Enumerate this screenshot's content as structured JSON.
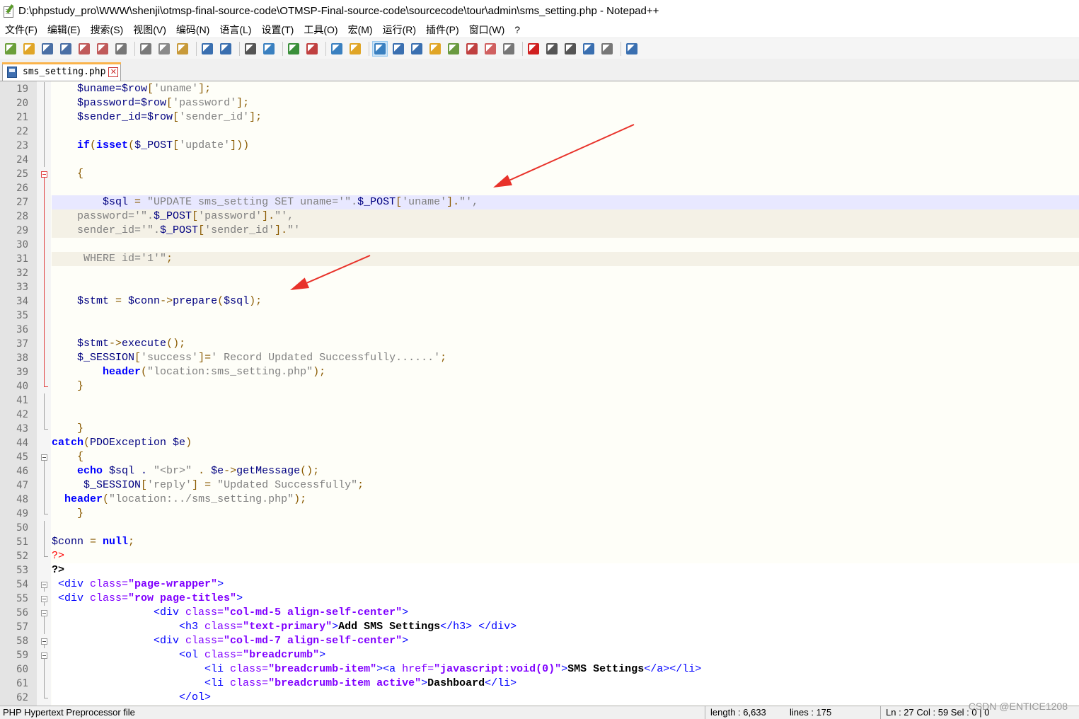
{
  "window": {
    "title": "D:\\phpstudy_pro\\WWW\\shenji\\otmsp-final-source-code\\OTMSP-Final-source-code\\sourcecode\\tour\\admin\\sms_setting.php - Notepad++"
  },
  "menu": [
    "文件(F)",
    "编辑(E)",
    "搜索(S)",
    "视图(V)",
    "编码(N)",
    "语言(L)",
    "设置(T)",
    "工具(O)",
    "宏(M)",
    "运行(R)",
    "插件(P)",
    "窗口(W)",
    "?"
  ],
  "toolbar": {
    "icons": [
      "new-file-icon",
      "open-file-icon",
      "save-icon",
      "save-all-icon",
      "close-icon",
      "close-all-icon",
      "print-icon",
      "|",
      "cut-icon",
      "copy-icon",
      "paste-icon",
      "|",
      "undo-icon",
      "redo-icon",
      "|",
      "find-icon",
      "replace-icon",
      "|",
      "zoom-in-icon",
      "zoom-out-icon",
      "|",
      "sync-vertical-icon",
      "sync-horizontal-icon",
      "|",
      "word-wrap-icon",
      "show-all-chars-icon",
      "indent-guide-icon",
      "user-language-icon",
      "doc-map-icon",
      "function-list-icon",
      "folder-workspace-icon",
      "monitor-icon",
      "|",
      "record-macro-icon",
      "stop-record-icon",
      "play-macro-icon",
      "run-macro-multiple-icon",
      "save-macro-icon",
      "|",
      "spell-check-icon"
    ],
    "icon_colors": [
      "#6b9f3a",
      "#e0a526",
      "#4a6fa5",
      "#4a6fa5",
      "#c05a5a",
      "#c05a5a",
      "#777777",
      "|",
      "#7a7a7a",
      "#8a8a8a",
      "#c89a3a",
      "|",
      "#3a6fb0",
      "#3a6fb0",
      "|",
      "#555555",
      "#3a80c0",
      "|",
      "#3a8f3a",
      "#c04040",
      "|",
      "#3a80c0",
      "#e0a526",
      "|",
      "#3a80c0",
      "#3a6fb0",
      "#3a6fb0",
      "#e0a526",
      "#6a9a40",
      "#c04040",
      "#d06060",
      "#777777",
      "|",
      "#d02020",
      "#555555",
      "#555555",
      "#3a6fb0",
      "#777777",
      "|",
      "#3a6fb0"
    ],
    "active_index": [
      24,
      40
    ]
  },
  "tab": {
    "label": "sms_setting.php",
    "close": "✕"
  },
  "editor": {
    "lines": [
      {
        "n": "19",
        "fold": "line",
        "tokens": [
          [
            "    ",
            "t"
          ],
          [
            "$uname=$row",
            "v"
          ],
          [
            "[",
            "o"
          ],
          [
            "'uname'",
            "s"
          ],
          [
            "];",
            "o"
          ]
        ]
      },
      {
        "n": "20",
        "fold": "line",
        "tokens": [
          [
            "    ",
            "t"
          ],
          [
            "$password=$row",
            "v"
          ],
          [
            "[",
            "o"
          ],
          [
            "'password'",
            "s"
          ],
          [
            "];",
            "o"
          ]
        ]
      },
      {
        "n": "21",
        "fold": "line",
        "tokens": [
          [
            "    ",
            "t"
          ],
          [
            "$sender_id=$row",
            "v"
          ],
          [
            "[",
            "o"
          ],
          [
            "'sender_id'",
            "s"
          ],
          [
            "];",
            "o"
          ]
        ]
      },
      {
        "n": "22",
        "fold": "line",
        "tokens": []
      },
      {
        "n": "23",
        "fold": "line",
        "tokens": [
          [
            "    ",
            "t"
          ],
          [
            "if",
            "k"
          ],
          [
            "(",
            "o"
          ],
          [
            "isset",
            "k"
          ],
          [
            "(",
            "o"
          ],
          [
            "$_POST",
            "v"
          ],
          [
            "[",
            "o"
          ],
          [
            "'update'",
            "s"
          ],
          [
            "]))",
            "o"
          ]
        ]
      },
      {
        "n": "24",
        "fold": "line",
        "tokens": []
      },
      {
        "n": "25",
        "fold": "box-red",
        "tokens": [
          [
            "    ",
            "t"
          ],
          [
            "{",
            "o"
          ]
        ]
      },
      {
        "n": "26",
        "fold": "line-red",
        "tokens": []
      },
      {
        "n": "27",
        "fold": "line-red",
        "hl": "cur",
        "tokens": [
          [
            "        ",
            "t"
          ],
          [
            "$sql",
            "v"
          ],
          [
            " = ",
            "o"
          ],
          [
            "\"UPDATE sms_setting SET uname='\".",
            "s"
          ],
          [
            "$_POST",
            "v"
          ],
          [
            "[",
            "o"
          ],
          [
            "'uname'",
            "s"
          ],
          [
            "].",
            "o"
          ],
          [
            "\"',",
            "s"
          ]
        ]
      },
      {
        "n": "28",
        "fold": "line-red",
        "hl": "shade",
        "tokens": [
          [
            "    ",
            "t"
          ],
          [
            "password='\".",
            "s"
          ],
          [
            "$_POST",
            "v"
          ],
          [
            "[",
            "o"
          ],
          [
            "'password'",
            "s"
          ],
          [
            "].",
            "o"
          ],
          [
            "\"',",
            "s"
          ]
        ]
      },
      {
        "n": "29",
        "fold": "line-red",
        "hl": "shade",
        "tokens": [
          [
            "    ",
            "t"
          ],
          [
            "sender_id='\".",
            "s"
          ],
          [
            "$_POST",
            "v"
          ],
          [
            "[",
            "o"
          ],
          [
            "'sender_id'",
            "s"
          ],
          [
            "].",
            "o"
          ],
          [
            "\"'",
            "s"
          ]
        ]
      },
      {
        "n": "30",
        "fold": "line-red",
        "tokens": []
      },
      {
        "n": "31",
        "fold": "line-red",
        "hl": "shade",
        "tokens": [
          [
            "     ",
            "t"
          ],
          [
            "WHERE id='1'\"",
            "s"
          ],
          [
            ";",
            "o"
          ]
        ]
      },
      {
        "n": "32",
        "fold": "line-red",
        "tokens": []
      },
      {
        "n": "33",
        "fold": "line-red",
        "tokens": []
      },
      {
        "n": "34",
        "fold": "line-red",
        "tokens": [
          [
            "    ",
            "t"
          ],
          [
            "$stmt",
            "v"
          ],
          [
            " = ",
            "o"
          ],
          [
            "$conn",
            "v"
          ],
          [
            "->",
            "o"
          ],
          [
            "prepare",
            "v"
          ],
          [
            "(",
            "o"
          ],
          [
            "$sql",
            "v"
          ],
          [
            ");",
            "o"
          ]
        ]
      },
      {
        "n": "35",
        "fold": "line-red",
        "tokens": []
      },
      {
        "n": "36",
        "fold": "line-red",
        "tokens": []
      },
      {
        "n": "37",
        "fold": "line-red",
        "tokens": [
          [
            "    ",
            "t"
          ],
          [
            "$stmt",
            "v"
          ],
          [
            "->",
            "o"
          ],
          [
            "execute",
            "v"
          ],
          [
            "();",
            "o"
          ]
        ]
      },
      {
        "n": "38",
        "fold": "line-red",
        "tokens": [
          [
            "    ",
            "t"
          ],
          [
            "$_SESSION",
            "v"
          ],
          [
            "[",
            "o"
          ],
          [
            "'success'",
            "s"
          ],
          [
            "]=",
            "o"
          ],
          [
            "' Record Updated Successfully......'",
            "s"
          ],
          [
            ";",
            "o"
          ]
        ]
      },
      {
        "n": "39",
        "fold": "line-red",
        "tokens": [
          [
            "        ",
            "t"
          ],
          [
            "header",
            "k"
          ],
          [
            "(",
            "o"
          ],
          [
            "\"location:sms_setting.php\"",
            "s"
          ],
          [
            ");",
            "o"
          ]
        ]
      },
      {
        "n": "40",
        "fold": "end-red",
        "tokens": [
          [
            "    ",
            "t"
          ],
          [
            "}",
            "o"
          ]
        ]
      },
      {
        "n": "41",
        "fold": "line",
        "tokens": []
      },
      {
        "n": "42",
        "fold": "line",
        "tokens": []
      },
      {
        "n": "43",
        "fold": "end",
        "tokens": [
          [
            "    ",
            "t"
          ],
          [
            "}",
            "o"
          ]
        ]
      },
      {
        "n": "44",
        "fold": "none",
        "tokens": [
          [
            "catch",
            "k"
          ],
          [
            "(",
            "o"
          ],
          [
            "PDOException $e",
            "v"
          ],
          [
            ")",
            "o"
          ]
        ]
      },
      {
        "n": "45",
        "fold": "box",
        "tokens": [
          [
            "    ",
            "t"
          ],
          [
            "{",
            "o"
          ]
        ]
      },
      {
        "n": "46",
        "fold": "line",
        "tokens": [
          [
            "    ",
            "t"
          ],
          [
            "echo",
            "k"
          ],
          [
            " $sql . ",
            "v"
          ],
          [
            "\"<br>\"",
            "s"
          ],
          [
            " . ",
            "o"
          ],
          [
            "$e",
            "v"
          ],
          [
            "->",
            "o"
          ],
          [
            "getMessage",
            "v"
          ],
          [
            "();",
            "o"
          ]
        ]
      },
      {
        "n": "47",
        "fold": "line",
        "tokens": [
          [
            "     ",
            "t"
          ],
          [
            "$_SESSION",
            "v"
          ],
          [
            "[",
            "o"
          ],
          [
            "'reply'",
            "s"
          ],
          [
            "] = ",
            "o"
          ],
          [
            "\"Updated Successfully\"",
            "s"
          ],
          [
            ";",
            "o"
          ]
        ]
      },
      {
        "n": "48",
        "fold": "line",
        "tokens": [
          [
            "  ",
            "t"
          ],
          [
            "header",
            "k"
          ],
          [
            "(",
            "o"
          ],
          [
            "\"location:../sms_setting.php\"",
            "s"
          ],
          [
            ");",
            "o"
          ]
        ]
      },
      {
        "n": "49",
        "fold": "end",
        "tokens": [
          [
            "    ",
            "t"
          ],
          [
            "}",
            "o"
          ]
        ]
      },
      {
        "n": "50",
        "fold": "line",
        "tokens": []
      },
      {
        "n": "51",
        "fold": "line",
        "tokens": [
          [
            "$conn",
            "v"
          ],
          [
            " = ",
            "o"
          ],
          [
            "null",
            "k"
          ],
          [
            ";",
            "o"
          ]
        ]
      },
      {
        "n": "52",
        "fold": "end",
        "tokens": [
          [
            "?>",
            "r"
          ]
        ]
      },
      {
        "n": "53",
        "fold": "none",
        "hl": "white",
        "tokens": [
          [
            "?>",
            "b"
          ]
        ]
      },
      {
        "n": "54",
        "fold": "box",
        "hl": "white",
        "tokens": [
          [
            " <div ",
            "h"
          ],
          [
            "class=",
            "a"
          ],
          [
            "\"page-wrapper\"",
            "av"
          ],
          [
            ">",
            "h"
          ]
        ]
      },
      {
        "n": "55",
        "fold": "box",
        "hl": "white",
        "tokens": [
          [
            " <div ",
            "h"
          ],
          [
            "class=",
            "a"
          ],
          [
            "\"row page-titles\"",
            "av"
          ],
          [
            ">",
            "h"
          ]
        ]
      },
      {
        "n": "56",
        "fold": "box",
        "hl": "white",
        "tokens": [
          [
            "                <div ",
            "h"
          ],
          [
            "class=",
            "a"
          ],
          [
            "\"col-md-5 align-self-center\"",
            "av"
          ],
          [
            ">",
            "h"
          ]
        ]
      },
      {
        "n": "57",
        "fold": "line",
        "hl": "white",
        "tokens": [
          [
            "                    <h3 ",
            "h"
          ],
          [
            "class=",
            "a"
          ],
          [
            "\"text-primary\"",
            "av"
          ],
          [
            ">",
            "h"
          ],
          [
            "Add SMS Settings",
            "b"
          ],
          [
            "</h3> </div>",
            "h"
          ]
        ]
      },
      {
        "n": "58",
        "fold": "box",
        "hl": "white",
        "tokens": [
          [
            "                <div ",
            "h"
          ],
          [
            "class=",
            "a"
          ],
          [
            "\"col-md-7 align-self-center\"",
            "av"
          ],
          [
            ">",
            "h"
          ]
        ]
      },
      {
        "n": "59",
        "fold": "box",
        "hl": "white",
        "tokens": [
          [
            "                    <ol ",
            "h"
          ],
          [
            "class=",
            "a"
          ],
          [
            "\"breadcrumb\"",
            "av"
          ],
          [
            ">",
            "h"
          ]
        ]
      },
      {
        "n": "60",
        "fold": "line",
        "hl": "white",
        "tokens": [
          [
            "                        <li ",
            "h"
          ],
          [
            "class=",
            "a"
          ],
          [
            "\"breadcrumb-item\"",
            "av"
          ],
          [
            "><a ",
            "h"
          ],
          [
            "href=",
            "a"
          ],
          [
            "\"javascript:void(0)\"",
            "av"
          ],
          [
            ">",
            "h"
          ],
          [
            "SMS Settings",
            "b"
          ],
          [
            "</a></li>",
            "h"
          ]
        ]
      },
      {
        "n": "61",
        "fold": "line",
        "hl": "white",
        "tokens": [
          [
            "                        <li ",
            "h"
          ],
          [
            "class=",
            "a"
          ],
          [
            "\"breadcrumb-item active\"",
            "av"
          ],
          [
            ">",
            "h"
          ],
          [
            "Dashboard",
            "b"
          ],
          [
            "</li>",
            "h"
          ]
        ]
      },
      {
        "n": "62",
        "fold": "end",
        "hl": "white",
        "tokens": [
          [
            "                    </ol>",
            "h"
          ]
        ]
      }
    ],
    "colors": {
      "t": "#000000",
      "v": "#000080",
      "o": "#8a5a00",
      "s": "#808080",
      "k": "#0000ff",
      "r": "#ff0000",
      "b": "#000000",
      "h": "#0000ff",
      "a": "#8000ff",
      "av": "#8000ff"
    }
  },
  "status": {
    "file_type": "PHP Hypertext Preprocessor file",
    "length": "length : 6,633",
    "lines": "lines : 175",
    "cursor": "Ln : 27    Col : 59    Sel : 0 | 0",
    "watermark": "CSDN @ENTICE1208"
  },
  "annotations": {
    "arrow_color": "#e8322a"
  }
}
